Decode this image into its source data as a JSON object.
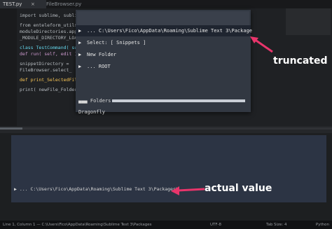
{
  "tabs": [
    {
      "label": "TEST.py",
      "close": "×",
      "active": true
    },
    {
      "label": "FileBrowser.py",
      "active": false
    }
  ],
  "code": {
    "lines": [
      "import sublime, sublime_plugin",
      "from enteleform_utils import *",
      "moduleDirectories.append(...)",
      "_MODULE_DIRECTORY_LOADER_",
      "class TestCommand( sublime_plugin.WindowCommand ):",
      "  def run( self, edit ):",
      "    snippetDirectory =",
      "    FileBrowser.select_",
      "def print_SelectedFile( ... ):",
      "  print( newFile_Folder... )"
    ]
  },
  "palette": {
    "rows": [
      {
        "arrow": "▶",
        "text": "...  C:\\Users\\Fico\\AppData\\Roaming\\Sublime Text 3\\Package",
        "selected": true
      },
      {
        "arrow": "▶",
        "text": "Select:  [ Snippets ]",
        "selected": false
      },
      {
        "arrow": "▶",
        "text": "New Folder",
        "selected": false
      },
      {
        "arrow": "▶",
        "text": "...  ROOT",
        "selected": false
      }
    ],
    "progress_label": "▄▄▄ Folders",
    "progress_value": 1.0,
    "hint": "Dragonfly"
  },
  "annotations": {
    "truncated": "truncated",
    "actual_value": "actual value",
    "arrow_color": "#e8356b"
  },
  "panel": {
    "line": "▶  ...  C:\\Users\\Fico\\AppData\\Roaming\\Sublime Text 3\\Packages\\"
  },
  "status": {
    "left": "Line 1, Column 1 — C:\\Users\\Fico\\AppData\\Roaming\\Sublime Text 3\\Packages",
    "mid": "UTF-8",
    "mid2": "Tab Size: 4",
    "right": "Python"
  }
}
